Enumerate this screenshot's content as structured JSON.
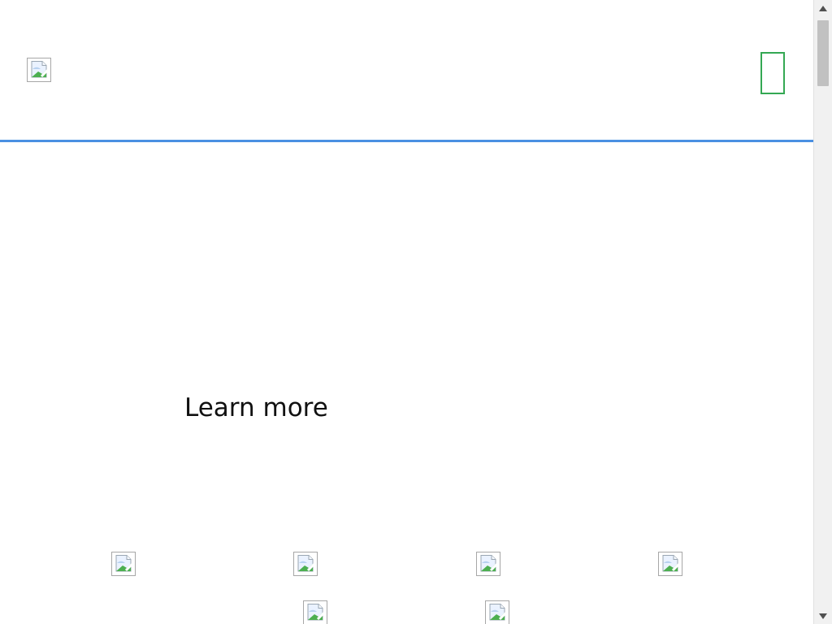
{
  "header": {
    "logo_icon": "broken-image-icon",
    "menu_toggle_icon": "menu-toggle-icon"
  },
  "main": {
    "learn_more_label": "Learn more"
  },
  "gallery": {
    "items": [
      {
        "icon": "broken-image-icon"
      },
      {
        "icon": "broken-image-icon"
      },
      {
        "icon": "broken-image-icon"
      },
      {
        "icon": "broken-image-icon"
      },
      {
        "icon": "broken-image-icon"
      },
      {
        "icon": "broken-image-icon"
      }
    ]
  },
  "colors": {
    "header_rule": "#4a90e2",
    "menu_toggle": "#34a853",
    "text": "#111111"
  },
  "scrollbar": {
    "icon_up": "scroll-up-arrow-icon",
    "icon_down": "scroll-down-arrow-icon"
  }
}
